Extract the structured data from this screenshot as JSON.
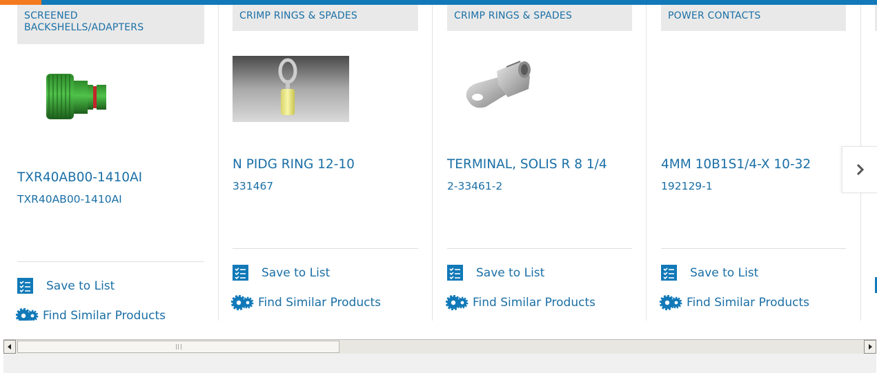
{
  "colors": {
    "brand_blue": "#1179b8",
    "accent_orange": "#f47a20",
    "link_blue": "#1a6fa6",
    "category_bg": "#e9e9e9"
  },
  "products": [
    {
      "category": "SCREENED BACKSHELLS/ADAPTERS",
      "title": "TXR40AB00-1410AI",
      "part_number": "TXR40AB00-1410AI",
      "save_label": "Save to List",
      "similar_label": "Find Similar Products",
      "image_icon": "green-backshell-image"
    },
    {
      "category": "CRIMP RINGS & SPADES",
      "title": "N PIDG RING 12-10",
      "part_number": "331467",
      "save_label": "Save to List",
      "similar_label": "Find Similar Products",
      "image_icon": "yellow-ring-terminal-image"
    },
    {
      "category": "CRIMP RINGS & SPADES",
      "title": "TERMINAL, SOLIS R 8 1/4",
      "part_number": "2-33461-2",
      "save_label": "Save to List",
      "similar_label": "Find Similar Products",
      "image_icon": "solistrand-ring-terminal-image"
    },
    {
      "category": "POWER CONTACTS",
      "title": "4MM 10B1S1/4-X 10-32",
      "part_number": "192129-1",
      "save_label": "Save to List",
      "similar_label": "Find Similar Products",
      "image_icon": ""
    }
  ],
  "carousel": {
    "next_icon": "chevron-right-icon"
  },
  "scrollbar": {
    "left_icon": "arrow-left-icon",
    "right_icon": "arrow-right-icon"
  }
}
